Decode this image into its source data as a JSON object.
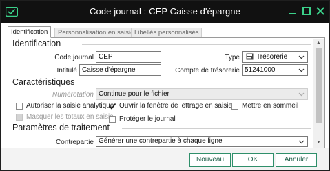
{
  "window": {
    "title": "Code journal : CEP Caisse d'épargne",
    "buttons": {
      "minimize": "minimize",
      "maximize": "maximize",
      "close": "close"
    }
  },
  "tabs": [
    {
      "label": "Identification"
    },
    {
      "label": "Personnalisation en saisie"
    },
    {
      "label": "Libellés personnalisés"
    }
  ],
  "identification": {
    "heading": "Identification",
    "code_label": "Code journal",
    "code_value": "CEP",
    "intitule_label": "Intitulé",
    "intitule_value": "Caisse d'épargne",
    "type_label": "Type",
    "type_value": "Trésorerie",
    "compte_label": "Compte de trésorerie",
    "compte_value": "51241000"
  },
  "caracteristiques": {
    "heading": "Caractéristiques",
    "numerotation_label": "Numérotation",
    "numerotation_value": "Continue pour le fichier",
    "cb_analytique": "Autoriser la saisie analytique",
    "cb_lettrage": "Ouvrir la fenêtre de lettrage en saisie",
    "cb_sommeil": "Mettre en sommeil",
    "cb_masquer": "Masquer les totaux en saisie",
    "cb_proteger": "Protéger le journal"
  },
  "traitement": {
    "heading": "Paramètres de traitement",
    "contrepartie_label": "Contrepartie",
    "contrepartie_value": "Générer une contrepartie à chaque ligne"
  },
  "footer": {
    "nouveau": "Nouveau",
    "ok": "OK",
    "annuler": "Annuler"
  },
  "colors": {
    "titlebar": "#111111",
    "accent": "#2f8f6a",
    "icon_green": "#3bd18a"
  },
  "states": {
    "cb_analytique": false,
    "cb_lettrage": true,
    "cb_sommeil": false,
    "cb_masquer": false,
    "cb_proteger": false
  }
}
